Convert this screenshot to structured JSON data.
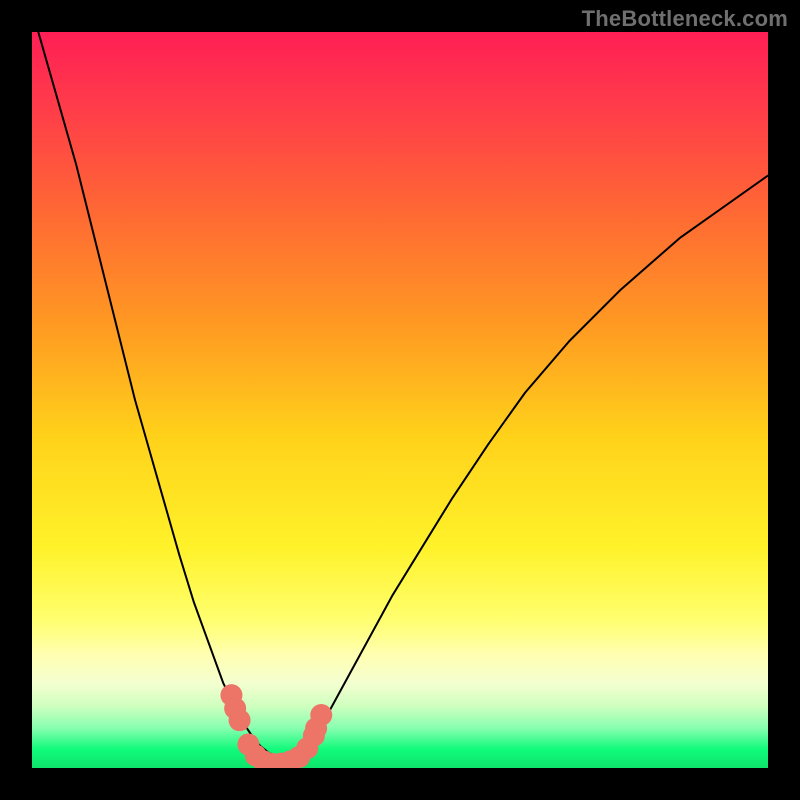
{
  "watermark": "TheBottleneck.com",
  "chart_data": {
    "type": "line",
    "title": "",
    "xlabel": "",
    "ylabel": "",
    "xlim": [
      0,
      100
    ],
    "ylim": [
      0,
      100
    ],
    "grid": false,
    "legend": "none",
    "background_gradient": {
      "stops": [
        {
          "pos": 0.0,
          "color": "#ff1f55"
        },
        {
          "pos": 0.1,
          "color": "#ff3b4a"
        },
        {
          "pos": 0.25,
          "color": "#ff6a33"
        },
        {
          "pos": 0.4,
          "color": "#ff9a22"
        },
        {
          "pos": 0.55,
          "color": "#ffd21a"
        },
        {
          "pos": 0.7,
          "color": "#fff22a"
        },
        {
          "pos": 0.8,
          "color": "#ffff70"
        },
        {
          "pos": 0.845,
          "color": "#ffffb0"
        },
        {
          "pos": 0.885,
          "color": "#f4ffd0"
        },
        {
          "pos": 0.915,
          "color": "#d0ffc0"
        },
        {
          "pos": 0.945,
          "color": "#8affb0"
        },
        {
          "pos": 0.975,
          "color": "#10fa7b"
        },
        {
          "pos": 1.0,
          "color": "#0ee46b"
        }
      ]
    },
    "series": [
      {
        "name": "bottleneck-curve",
        "color": "#000000",
        "stroke_width": 2,
        "x": [
          0,
          2,
          4,
          6,
          8,
          10,
          12,
          14,
          16,
          18,
          20,
          22,
          24,
          26,
          27,
          28,
          29,
          30,
          31,
          32,
          33,
          34,
          35,
          36,
          37,
          38,
          40,
          43,
          46,
          49,
          53,
          57,
          62,
          67,
          73,
          80,
          88,
          100
        ],
        "y": [
          103,
          96,
          89,
          82,
          74,
          66,
          58,
          50,
          43,
          36,
          29,
          22.5,
          17,
          11.5,
          9.5,
          7.5,
          5.7,
          4.2,
          3.0,
          2.2,
          1.6,
          1.3,
          1.2,
          1.35,
          2.2,
          3.7,
          7.0,
          12.5,
          18,
          23.5,
          30,
          36.5,
          44,
          51,
          58,
          65,
          72,
          80.5
        ]
      }
    ],
    "markers": {
      "name": "highlight-points",
      "color": "#ed7568",
      "radius": 11,
      "points": [
        {
          "x": 27.1,
          "y": 9.9
        },
        {
          "x": 27.6,
          "y": 8.1
        },
        {
          "x": 28.2,
          "y": 6.5
        },
        {
          "x": 29.4,
          "y": 3.2
        },
        {
          "x": 30.4,
          "y": 1.7
        },
        {
          "x": 31.5,
          "y": 0.9
        },
        {
          "x": 32.7,
          "y": 0.55
        },
        {
          "x": 33.9,
          "y": 0.6
        },
        {
          "x": 35.1,
          "y": 0.9
        },
        {
          "x": 36.3,
          "y": 1.5
        },
        {
          "x": 37.4,
          "y": 2.7
        },
        {
          "x": 38.3,
          "y": 4.4
        },
        {
          "x": 38.6,
          "y": 5.4
        },
        {
          "x": 39.3,
          "y": 7.2
        }
      ]
    }
  }
}
